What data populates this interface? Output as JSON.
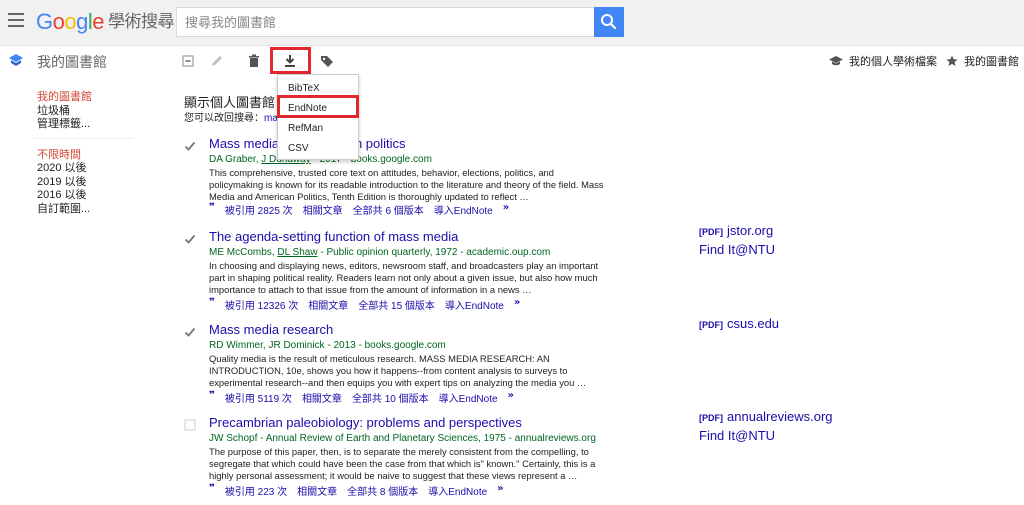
{
  "header": {
    "logo": "Google",
    "logo_sub": "學術搜尋",
    "search_placeholder": "搜尋我的圖書館"
  },
  "toolbar": {
    "library_title": "我的圖書館",
    "profile_link": "我的個人學術檔案",
    "library_link": "我的圖書館"
  },
  "sidebar": {
    "groups": [
      [
        "我的圖書館",
        "垃圾桶",
        "管理標籤..."
      ],
      [
        "不限時間",
        "2020 以後",
        "2019 以後",
        "2016 以後",
        "自訂範圍..."
      ]
    ]
  },
  "content": {
    "title": "顯示個人圖書館",
    "subtitle": "您可以改回搜尋：",
    "subtitle_link": "ma"
  },
  "dropdown": {
    "items": [
      "BibTeX",
      "EndNote",
      "RefMan",
      "CSV"
    ],
    "highlighted": "EndNote"
  },
  "results": [
    {
      "checked": true,
      "title": "Mass media and American politics",
      "authors_pre": "DA Graber, ",
      "authors_ul": "J Dunaway",
      "authors_post": " - 2017 - books.google.com",
      "snippet": "This comprehensive, trusted core text on attitudes, behavior, elections, politics, and policymaking is known for its readable introduction to the literature and theory of the field. Mass Media and American Politics, Tenth Edition is thoroughly updated to reflect …",
      "cited": "被引用 2825 次",
      "related": "相關文章",
      "versions": "全部共 6 個版本",
      "import": "導入EndNote",
      "side": []
    },
    {
      "checked": true,
      "title": "The agenda-setting function of mass media",
      "authors_pre": "ME McCombs, ",
      "authors_ul": "DL Shaw",
      "authors_post": " - Public opinion quarterly, 1972 - academic.oup.com",
      "snippet": "In choosing and displaying news, editors, newsroom staff, and broadcasters play an important part in shaping political reality. Readers learn not only about a given issue, but also how much importance to attach to that issue from the amount of information in a news …",
      "cited": "被引用 12326 次",
      "related": "相關文章",
      "versions": "全部共 15 個版本",
      "import": "導入EndNote",
      "side": [
        {
          "pdf": "[PDF]",
          "text": "jstor.org"
        },
        {
          "pdf": "",
          "text": "Find It@NTU"
        }
      ]
    },
    {
      "checked": true,
      "title": "Mass media research",
      "authors_pre": "RD Wimmer, JR Dominick",
      "authors_ul": "",
      "authors_post": " - 2013 - books.google.com",
      "snippet": "Quality media is the result of meticulous research. MASS MEDIA RESEARCH: AN INTRODUCTION, 10e, shows you how it happens--from content analysis to surveys to experimental research--and then equips you with expert tips on analyzing the media you …",
      "cited": "被引用 5119 次",
      "related": "相關文章",
      "versions": "全部共 10 個版本",
      "import": "導入EndNote",
      "side": [
        {
          "pdf": "[PDF]",
          "text": "csus.edu"
        }
      ]
    },
    {
      "checked": false,
      "title": "Precambrian paleobiology: problems and perspectives",
      "authors_pre": "JW Schopf",
      "authors_ul": "",
      "authors_post": " - Annual Review of Earth and Planetary Sciences, 1975 - annualreviews.org",
      "snippet": "The purpose of this paper, then, is to separate the merely consistent from the compelling, to segregate that which could have been the case from that which is\" known.\" Certainly, this is a highly personal assessment; it would be naive to suggest that these views represent a …",
      "cited": "被引用 223 次",
      "related": "相關文章",
      "versions": "全部共 8 個版本",
      "import": "導入EndNote",
      "side": [
        {
          "pdf": "[PDF]",
          "text": "annualreviews.org"
        },
        {
          "pdf": "",
          "text": "Find It@NTU"
        }
      ]
    }
  ],
  "colors": {
    "link": "#1a0dab",
    "green": "#006621",
    "active": "#d14836",
    "highlight": "#e4262e",
    "search_button": "#4285f4"
  }
}
